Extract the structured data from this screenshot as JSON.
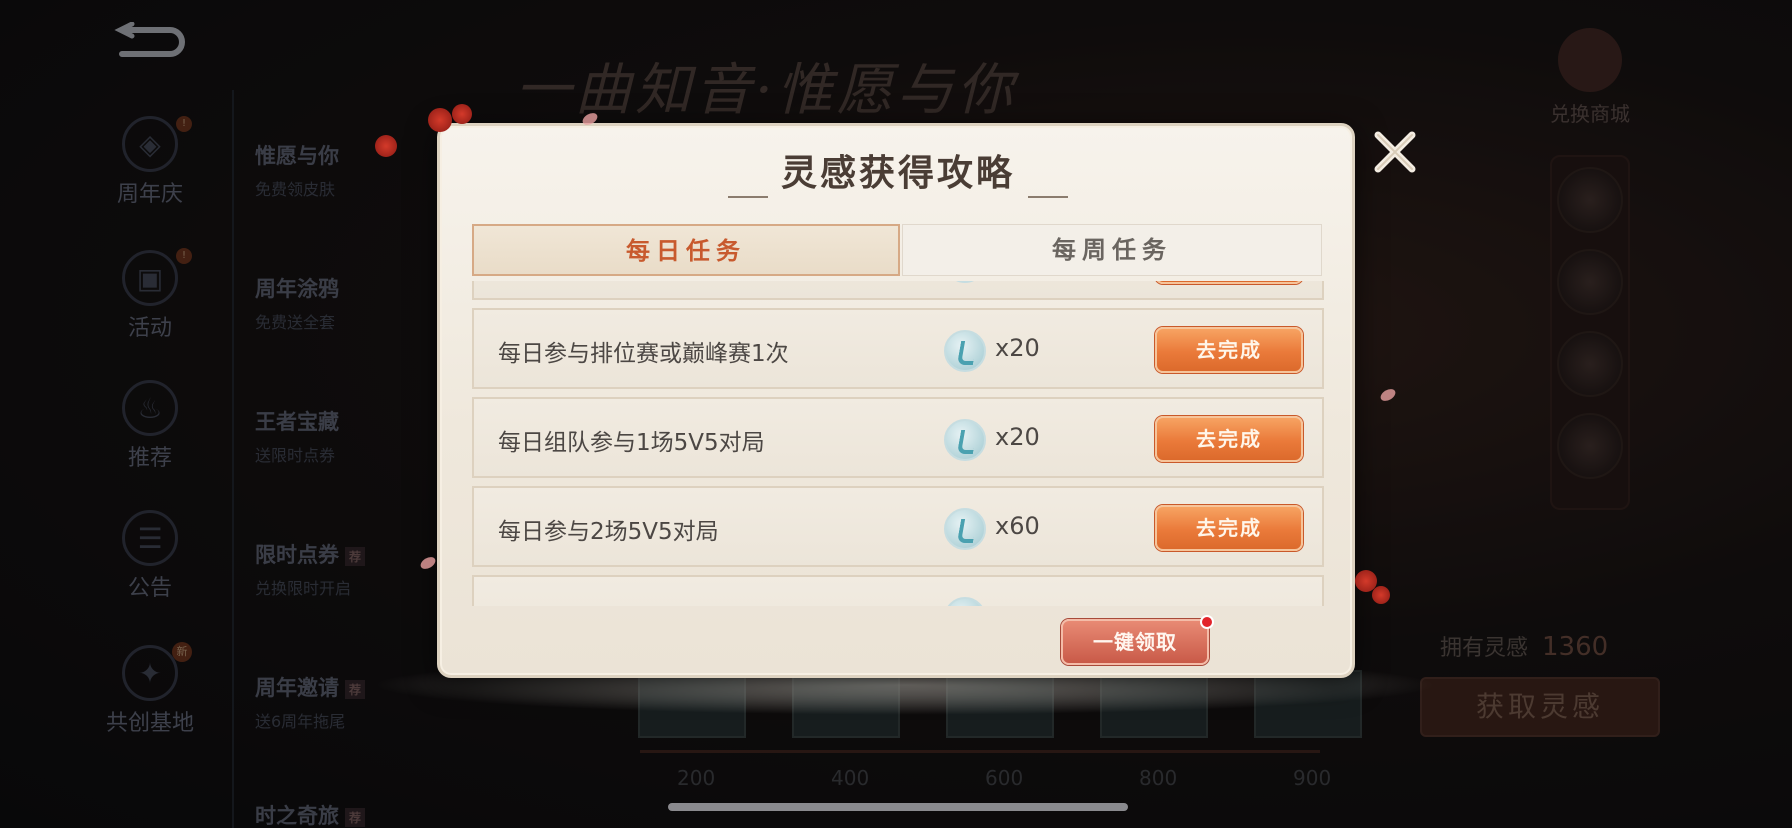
{
  "background": {
    "banner_title": "一曲知音·惟愿与你",
    "nav_items": [
      {
        "label": "周年庆",
        "icon": "anniversary-icon",
        "badge": "!"
      },
      {
        "label": "活动",
        "icon": "gift-icon",
        "badge": "!"
      },
      {
        "label": "推荐",
        "icon": "flame-icon",
        "badge": ""
      },
      {
        "label": "公告",
        "icon": "notice-icon",
        "badge": ""
      },
      {
        "label": "共创基地",
        "icon": "cocreate-icon",
        "badge": "新"
      }
    ],
    "sub_items": [
      {
        "title": "惟愿与你",
        "desc": "免费领皮肤",
        "tag": ""
      },
      {
        "title": "周年涂鸦",
        "desc": "免费送全套",
        "tag": ""
      },
      {
        "title": "王者宝藏",
        "desc": "送限时点券",
        "tag": ""
      },
      {
        "title": "限时点券",
        "desc": "兑换限时开启",
        "tag": "荐"
      },
      {
        "title": "周年邀请",
        "desc": "送6周年拖尾",
        "tag": "荐"
      },
      {
        "title": "时之奇旅",
        "desc": "",
        "tag": "荐"
      }
    ],
    "shop_label": "兑换商城",
    "inspire_label": "拥有灵感",
    "inspire_value": "1360",
    "get_inspire_button": "获取灵感",
    "track_labels": [
      "200",
      "400",
      "600",
      "800",
      "900"
    ]
  },
  "modal": {
    "title": "灵感获得攻略",
    "tabs": {
      "daily": "每日任务",
      "weekly": "每周任务",
      "active": "daily"
    },
    "tasks": [
      {
        "name": "每日参与排位赛或巅峰赛1次",
        "reward_icon": "inspiration-icon",
        "qty": "x20",
        "button": "去完成"
      },
      {
        "name": "每日组队参与1场5V5对局",
        "reward_icon": "inspiration-icon",
        "qty": "x20",
        "button": "去完成"
      },
      {
        "name": "每日参与2场5V5对局",
        "reward_icon": "inspiration-icon",
        "qty": "x60",
        "button": "去完成"
      }
    ],
    "claim_all_button": "一键领取"
  },
  "colors": {
    "accent_orange": "#ea7a3a",
    "claim_red": "#c95a48",
    "tab_active_text": "#c85a2e",
    "notification_dot": "#e2242a"
  }
}
